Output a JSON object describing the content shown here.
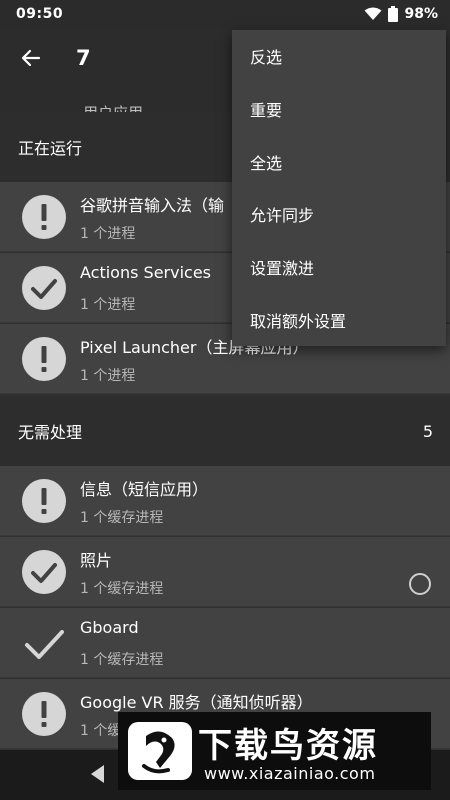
{
  "status_bar": {
    "time": "09:50",
    "battery": "98%"
  },
  "app_bar": {
    "title": "7"
  },
  "tabs": [
    {
      "label": "用户应用"
    }
  ],
  "sections": {
    "running": {
      "title": "正在运行"
    },
    "no_action": {
      "title": "无需处理",
      "count": "5"
    }
  },
  "running_apps": [
    {
      "name": "谷歌拼音输入法（输",
      "detail": "1 个进程",
      "icon": "exclamation-circle-icon"
    },
    {
      "name": "Actions Services",
      "detail": "1 个进程",
      "icon": "check-circle-icon"
    },
    {
      "name": "Pixel Launcher（主屏幕应用）",
      "detail": "1 个进程",
      "icon": "exclamation-circle-icon"
    }
  ],
  "no_action_apps": [
    {
      "name": "信息（短信应用）",
      "detail": "1 个缓存进程",
      "icon": "exclamation-circle-icon"
    },
    {
      "name": "照片",
      "detail": "1 个缓存进程",
      "icon": "check-circle-icon"
    },
    {
      "name": "Gboard",
      "detail": "1 个缓存进程",
      "icon": "checkmark-icon"
    },
    {
      "name": "Google VR 服务（通知侦听器）",
      "detail": "1 个缓存进程",
      "icon": "exclamation-circle-icon"
    }
  ],
  "menu": {
    "items": [
      {
        "label": "反选"
      },
      {
        "label": "重要"
      },
      {
        "label": "全选"
      },
      {
        "label": "允许同步"
      },
      {
        "label": "设置激进"
      },
      {
        "label": "取消额外设置"
      }
    ]
  },
  "watermark": {
    "title": "下载鸟资源",
    "url": "www.xiazainiao.com"
  },
  "colors": {
    "accent": "#64b5f6",
    "row_bg": "#424242",
    "icon_fill": "#d6d6d6"
  }
}
